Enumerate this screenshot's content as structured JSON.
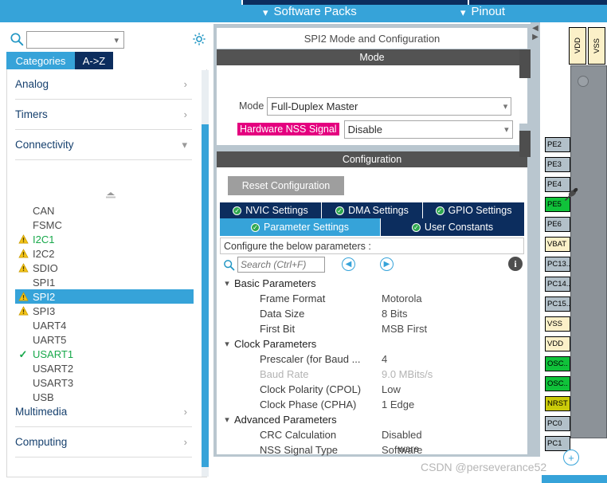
{
  "topbar": {
    "items": [
      {
        "label": "Software Packs",
        "icon": "chevron-down-icon"
      },
      {
        "label": "Pinout",
        "icon": "chevron-down-icon"
      }
    ]
  },
  "left_panel": {
    "search": {
      "value": "",
      "icon": "search-icon",
      "chevron": "⌵"
    },
    "gear_icon": "gear-icon",
    "tabs": [
      {
        "label": "Categories",
        "active": true
      },
      {
        "label": "A->Z",
        "active": false
      }
    ],
    "groups": [
      {
        "label": "Analog",
        "expanded": false,
        "arrow": "›"
      },
      {
        "label": "Timers",
        "expanded": false,
        "arrow": "›"
      },
      {
        "label": "Connectivity",
        "expanded": true,
        "arrow": "⌵"
      },
      {
        "label": "Multimedia",
        "expanded": false,
        "arrow": "›"
      },
      {
        "label": "Computing",
        "expanded": false,
        "arrow": "›"
      }
    ],
    "peripherals": [
      {
        "label": "CAN",
        "status": "none",
        "selected": false
      },
      {
        "label": "FSMC",
        "status": "none",
        "selected": false
      },
      {
        "label": "I2C1",
        "status": "warning",
        "selected": false,
        "green_text": true
      },
      {
        "label": "I2C2",
        "status": "warning",
        "selected": false
      },
      {
        "label": "SDIO",
        "status": "warning",
        "selected": false
      },
      {
        "label": "SPI1",
        "status": "none",
        "selected": false
      },
      {
        "label": "SPI2",
        "status": "warning",
        "selected": true
      },
      {
        "label": "SPI3",
        "status": "warning",
        "selected": false
      },
      {
        "label": "UART4",
        "status": "none",
        "selected": false
      },
      {
        "label": "UART5",
        "status": "none",
        "selected": false
      },
      {
        "label": "USART1",
        "status": "check",
        "selected": false,
        "green_text": true
      },
      {
        "label": "USART2",
        "status": "none",
        "selected": false
      },
      {
        "label": "USART3",
        "status": "none",
        "selected": false
      },
      {
        "label": "USB",
        "status": "none",
        "selected": false
      }
    ]
  },
  "config_panel": {
    "title": "SPI2 Mode and Configuration",
    "mode_section": {
      "header": "Mode",
      "fields": [
        {
          "label": "Mode",
          "value": "Full-Duplex Master",
          "highlight": false
        },
        {
          "label": "Hardware NSS Signal",
          "value": "Disable",
          "highlight": true
        }
      ]
    },
    "configuration_section": {
      "header": "Configuration",
      "reset_button": "Reset Configuration",
      "tabs_row1": [
        {
          "label": "NVIC Settings",
          "active": false
        },
        {
          "label": "DMA Settings",
          "active": false
        },
        {
          "label": "GPIO Settings",
          "active": false
        }
      ],
      "tabs_row2": [
        {
          "label": "Parameter Settings",
          "active": true
        },
        {
          "label": "User Constants",
          "active": false
        }
      ],
      "configure_hint": "Configure the below parameters :",
      "toolbar": {
        "search_placeholder": "Search (Ctrl+F)",
        "search_value": "",
        "prev_icon": "chevron-left-circle-icon",
        "next_icon": "chevron-right-circle-icon",
        "info_icon": "info-icon"
      },
      "parameters": [
        {
          "type": "group",
          "name": "Basic Parameters",
          "expanded": true
        },
        {
          "type": "param",
          "name": "Frame Format",
          "value": "Motorola",
          "dim": false
        },
        {
          "type": "param",
          "name": "Data Size",
          "value": "8 Bits",
          "dim": false
        },
        {
          "type": "param",
          "name": "First Bit",
          "value": "MSB First",
          "dim": false
        },
        {
          "type": "group",
          "name": "Clock Parameters",
          "expanded": true
        },
        {
          "type": "param",
          "name": "Prescaler (for Baud ...",
          "value": "4",
          "dim": false
        },
        {
          "type": "param",
          "name": "Baud Rate",
          "value": "9.0 MBits/s",
          "dim": true
        },
        {
          "type": "param",
          "name": "Clock Polarity (CPOL)",
          "value": "Low",
          "dim": false
        },
        {
          "type": "param",
          "name": "Clock Phase (CPHA)",
          "value": "1 Edge",
          "dim": false
        },
        {
          "type": "group",
          "name": "Advanced Parameters",
          "expanded": true
        },
        {
          "type": "param",
          "name": "CRC Calculation",
          "value": "Disabled",
          "dim": false
        },
        {
          "type": "param",
          "name": "NSS Signal Type",
          "value": "Software",
          "dim": false
        }
      ]
    }
  },
  "chip_view": {
    "vertical_pins": [
      {
        "label": "VDD",
        "color": "cream"
      },
      {
        "label": "VSS",
        "color": "cream"
      }
    ],
    "side_pins": [
      {
        "label": "PE2",
        "color": "gray"
      },
      {
        "label": "PE3",
        "color": "gray"
      },
      {
        "label": "PE4",
        "color": "gray"
      },
      {
        "label": "PE5",
        "color": "green"
      },
      {
        "label": "PE6",
        "color": "gray"
      },
      {
        "label": "VBAT",
        "color": "cream"
      },
      {
        "label": "PC13..",
        "color": "gray"
      },
      {
        "label": "PC14..",
        "color": "gray"
      },
      {
        "label": "PC15..",
        "color": "gray"
      },
      {
        "label": "VSS",
        "color": "cream"
      },
      {
        "label": "VDD",
        "color": "cream"
      },
      {
        "label": "OSC..",
        "color": "green"
      },
      {
        "label": "OSC..",
        "color": "green"
      },
      {
        "label": "NRST",
        "color": "olive"
      },
      {
        "label": "PC0",
        "color": "gray"
      },
      {
        "label": "PC1",
        "color": "gray"
      }
    ],
    "pushpin_icon": "pushpin-icon",
    "zoom_in_icon": "zoom-in-icon"
  },
  "footer": {
    "watermark": "CSDN @perseverance52",
    "fragment": "ware"
  },
  "colors": {
    "accent_blue": "#36a3d9",
    "dark_navy": "#0c2d5e",
    "highlight_magenta": "#e4007f",
    "green_status": "#17a84a",
    "panel_gray": "#b9c6cf"
  }
}
